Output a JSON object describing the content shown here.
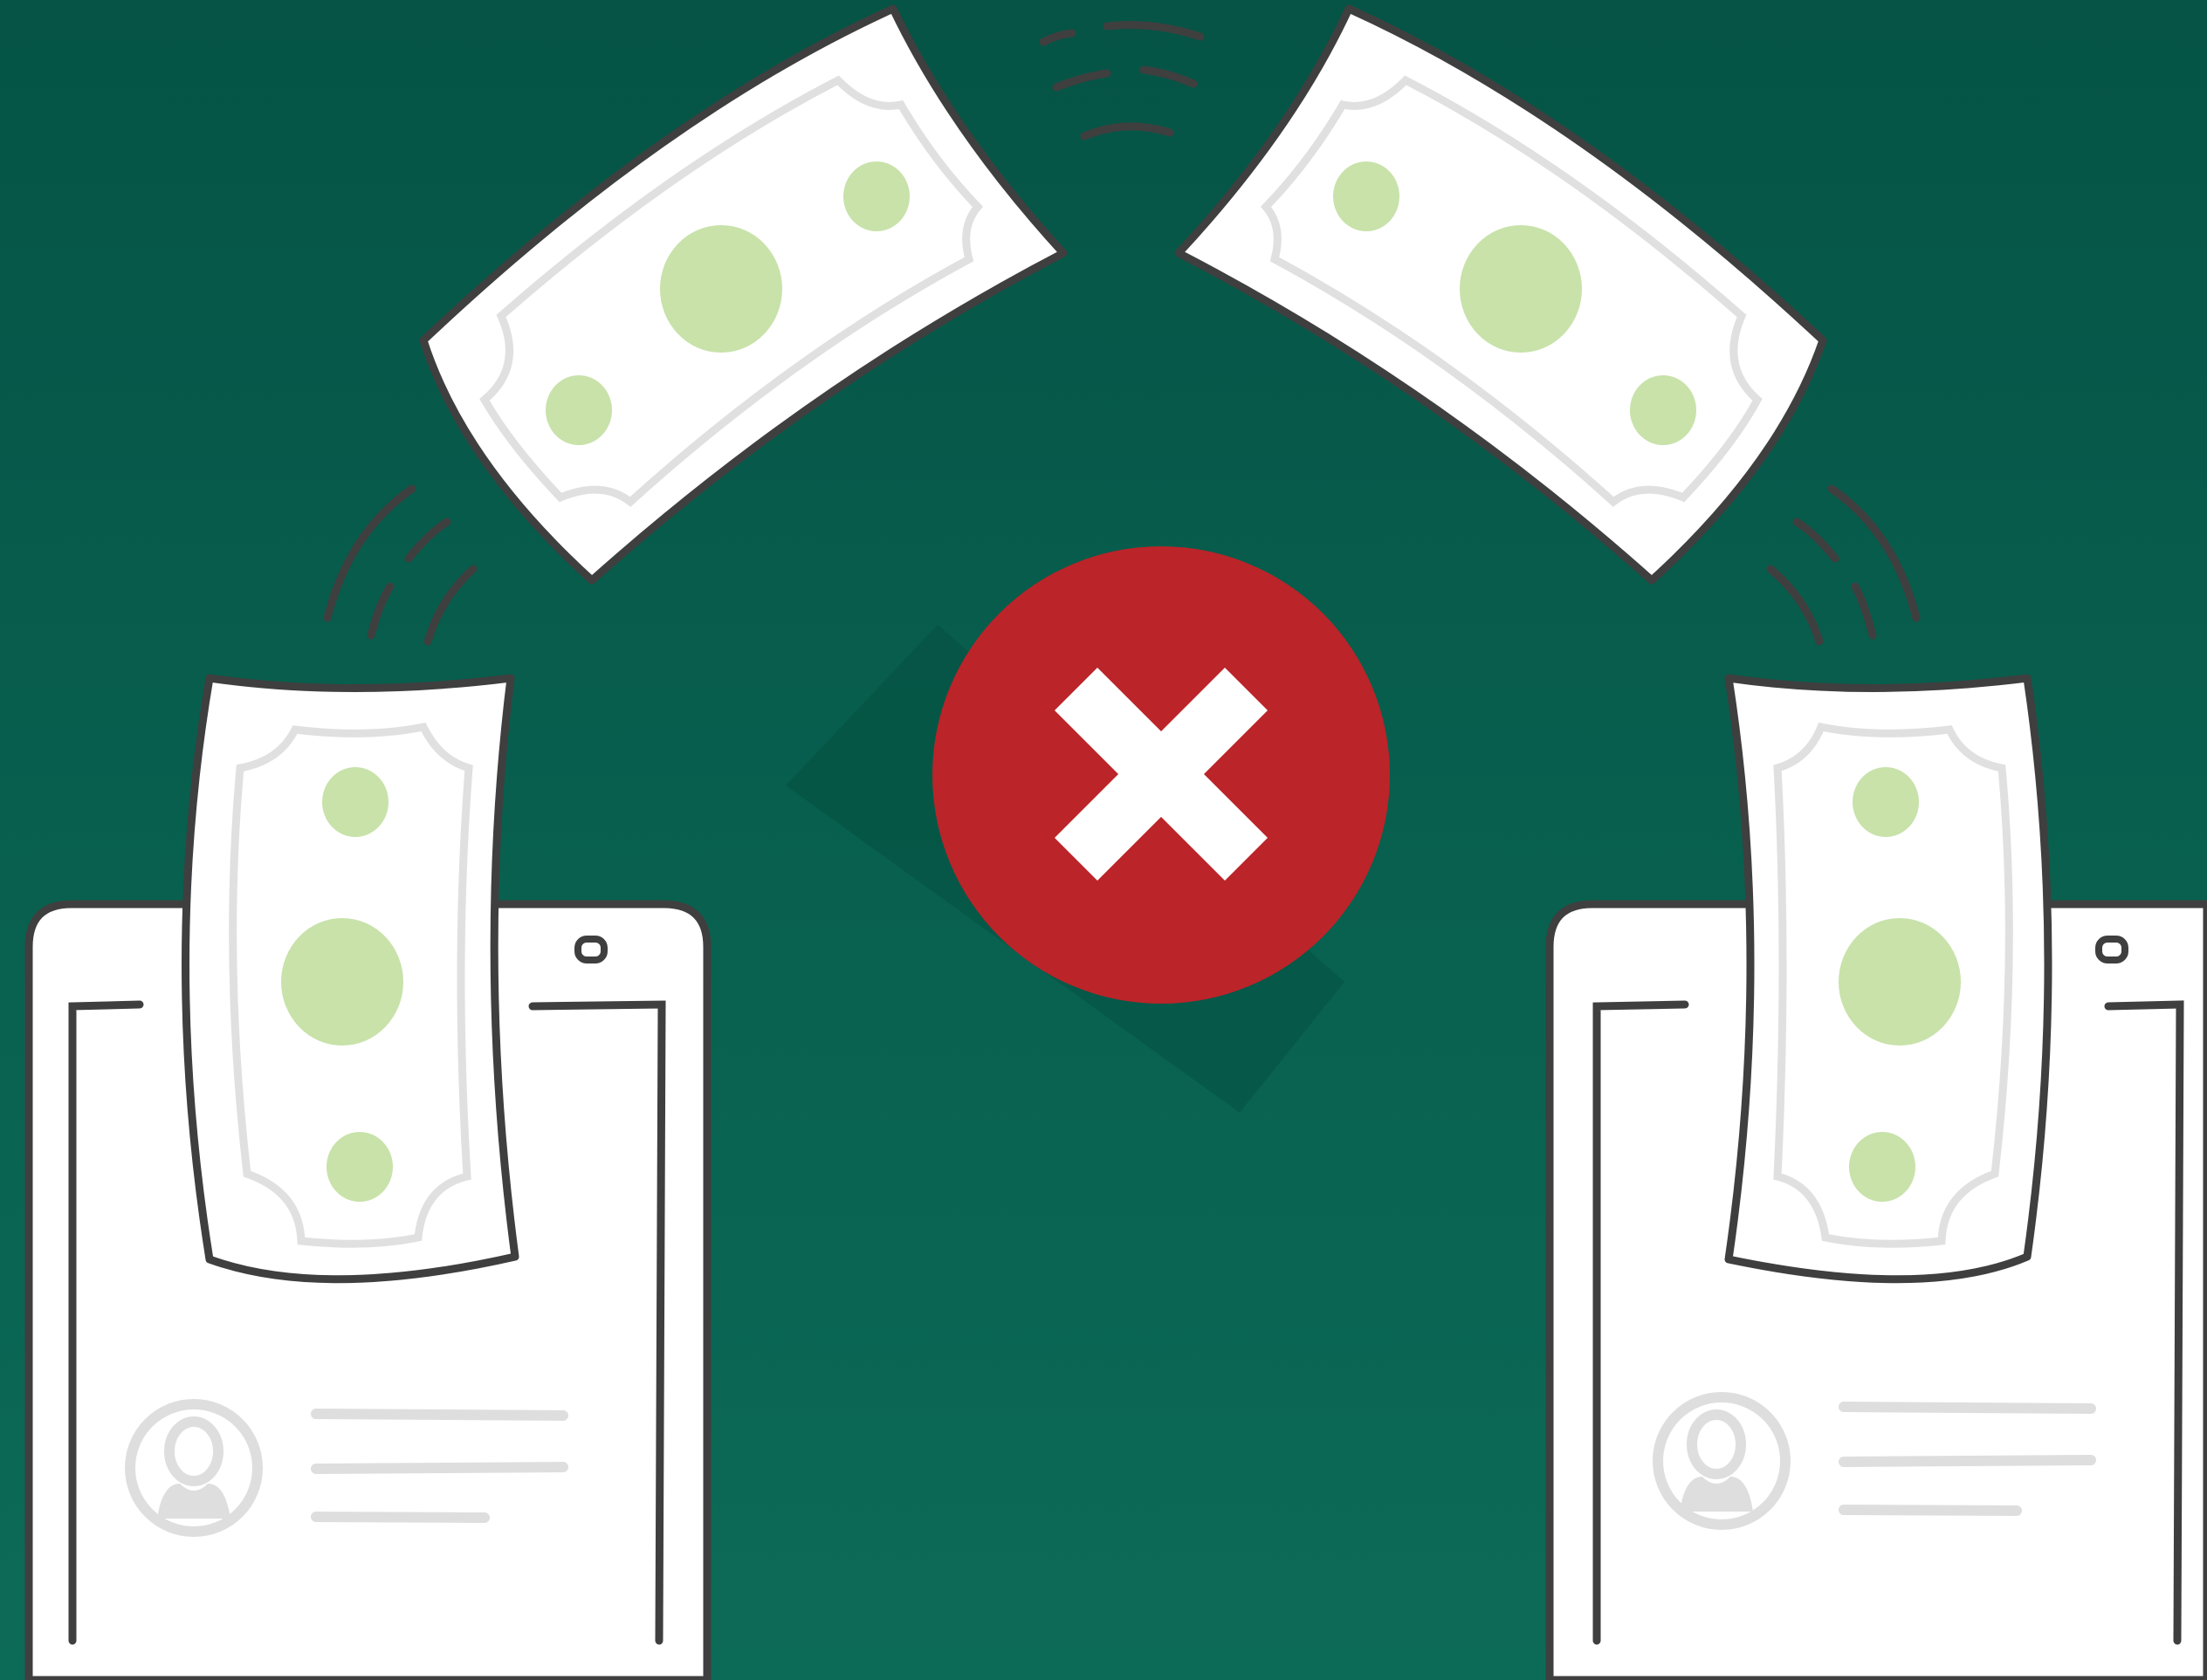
{
  "scene": {
    "description_free": true,
    "colors": {
      "background_top": "#055446",
      "background_bottom": "#0c6b57",
      "outline": "#3f3f3f",
      "bill_paper": "#ffffff",
      "bill_inner_border": "#e0e0e0",
      "bill_dots": "#c8e2aa",
      "reject_circle": "#bb2429",
      "reject_mark": "#ffffff",
      "profile_gray": "#dedede"
    },
    "icons": {
      "reject": "close-icon",
      "profile": "user-icon",
      "money": "banknote-icon",
      "device": "phone-icon"
    }
  }
}
